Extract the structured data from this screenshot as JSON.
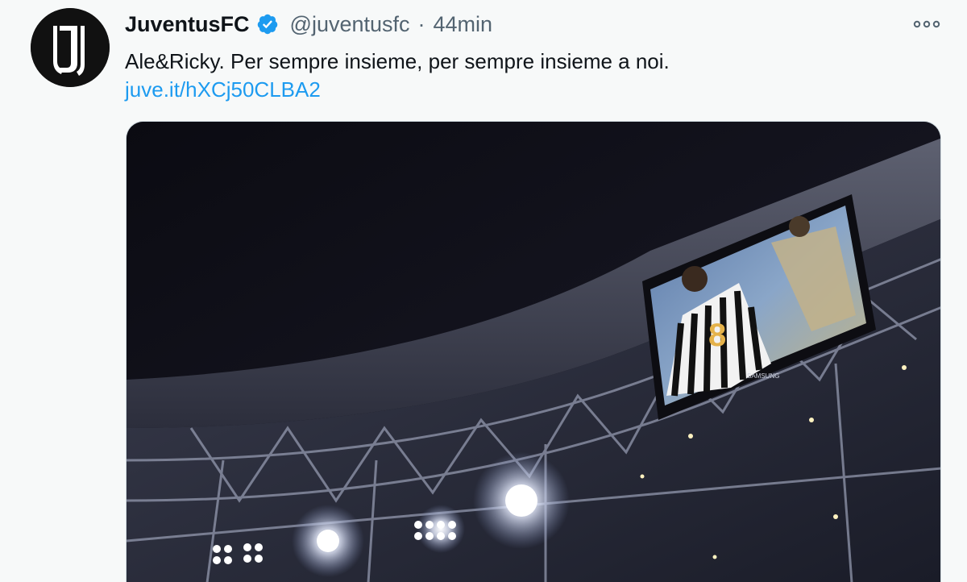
{
  "tweet": {
    "display_name": "JuventusFC",
    "handle": "@juventusfc",
    "separator": "·",
    "time": "44min",
    "text": "Ale&Ricky. Per sempre insieme, per sempre insieme a noi.",
    "link": "juve.it/hXCj50CLBA2",
    "verified": true,
    "avatar_icon": "juventus-logo-icon",
    "more_icon": "more-options-icon"
  },
  "media": {
    "description_icon": "stadium-photo",
    "scoreboard_number": "8",
    "scoreboard_brand": "SAMSUNG"
  },
  "colors": {
    "verified": "#1d9bf0",
    "link": "#1d9bf0",
    "muted": "#536471",
    "background": "#f7f9f9"
  }
}
